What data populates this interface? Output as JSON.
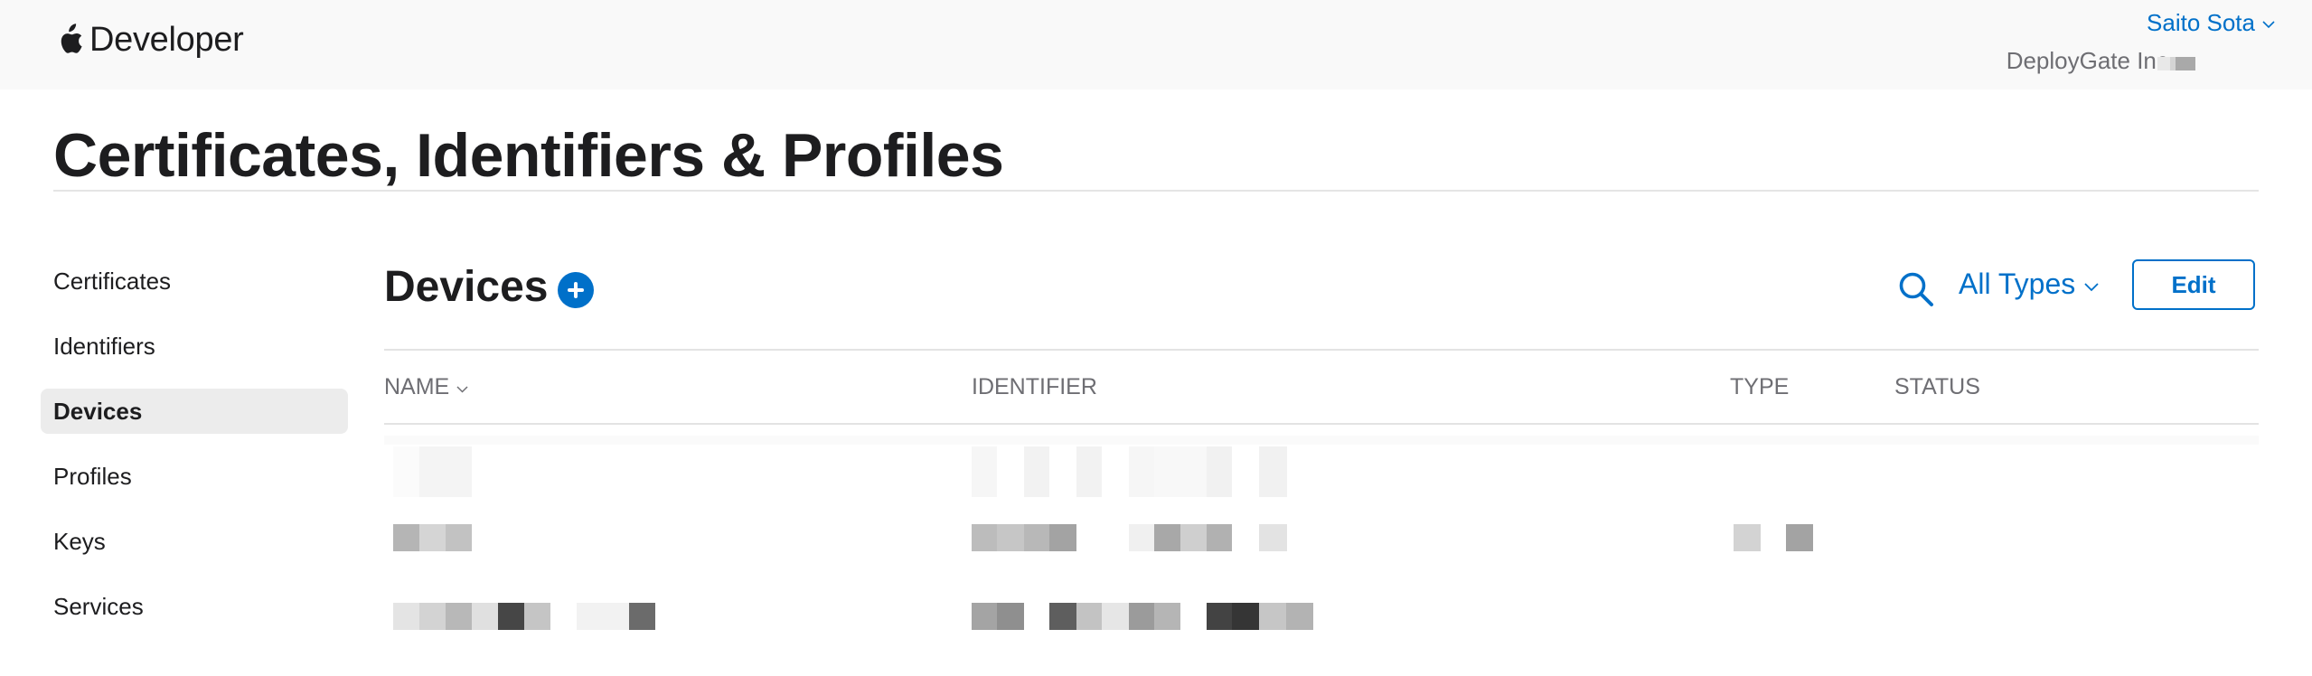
{
  "header": {
    "brand": "Developer",
    "user_name": "Saito Sota",
    "team_name": "DeployGate Inc. -"
  },
  "page": {
    "title": "Certificates, Identifiers & Profiles"
  },
  "sidebar": {
    "items": [
      {
        "label": "Certificates",
        "active": false
      },
      {
        "label": "Identifiers",
        "active": false
      },
      {
        "label": "Devices",
        "active": true
      },
      {
        "label": "Profiles",
        "active": false
      },
      {
        "label": "Keys",
        "active": false
      },
      {
        "label": "Services",
        "active": false
      }
    ]
  },
  "main": {
    "section_title": "Devices",
    "filter_label": "All Types",
    "edit_label": "Edit",
    "columns": [
      "NAME",
      "IDENTIFIER",
      "TYPE",
      "STATUS"
    ]
  },
  "icons": {
    "brand": "apple-logo-icon",
    "add": "plus-circle-icon",
    "search": "search-icon",
    "dropdown": "chevron-down-icon"
  },
  "colors": {
    "accent": "#0070c9",
    "text": "#1d1d1f",
    "muted": "#6e6e73",
    "header_bg": "#f9f9f9",
    "active_bg": "#ececec"
  }
}
